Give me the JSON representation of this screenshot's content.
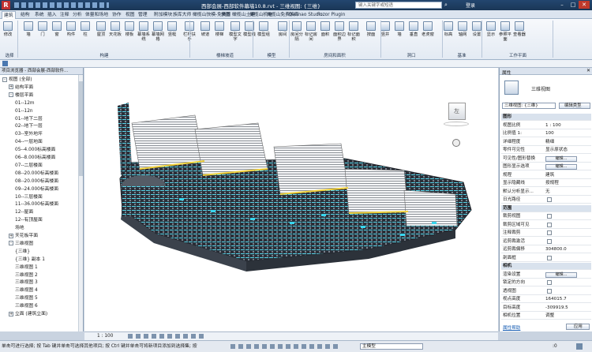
{
  "titlebar": {
    "title": "西部会展-西部软件幕墙10.8.rvt - 三维视图: {三维}",
    "search_placeholder": "键入关键字或短语",
    "user": "登录"
  },
  "tabs": [
    "建筑",
    "结构",
    "系统",
    "插入",
    "注释",
    "分析",
    "体量和场地",
    "协作",
    "视图",
    "管理",
    "附加模块",
    "族库大师",
    "橄榄山快模-免费版",
    "快图",
    "橄榄山土建",
    "橄榄山机电",
    "橄榄山免费族库",
    "Daimao Studio",
    "Fuzor Plugin"
  ],
  "ribbon": {
    "buttons": [
      "修改",
      "墙",
      "门",
      "窗",
      "构件",
      "柱",
      "屋顶",
      "天花板",
      "楼板",
      "幕墙系统",
      "幕墙网格",
      "竖梃",
      "栏杆扶手",
      "坡道",
      "楼梯",
      "模型文字",
      "模型线",
      "模型组",
      "房间",
      "房间分隔",
      "标记房间",
      "面积",
      "面积边界",
      "标记面积",
      "按面",
      "竖井",
      "墙",
      "垂直",
      "老虎窗",
      "标高",
      "轴网",
      "设置",
      "显示",
      "参照平面",
      "查看器"
    ],
    "groups": [
      "选择",
      "构建",
      "楼梯坡道",
      "模型",
      "房间和面积",
      "洞口",
      "基准",
      "工作平面"
    ]
  },
  "browser": {
    "title": "项目浏览器 - 西部会展-西部软件...",
    "rows": [
      {
        "label": "视图 (全部)",
        "level": 0,
        "exp": "-"
      },
      {
        "label": "结构平面",
        "level": 1,
        "exp": "+"
      },
      {
        "label": "楼层平面",
        "level": 1,
        "exp": "-"
      },
      {
        "label": "01--12m",
        "level": 2,
        "exp": ""
      },
      {
        "label": "01--12n",
        "level": 2,
        "exp": ""
      },
      {
        "label": "01--地下二层",
        "level": 2,
        "exp": ""
      },
      {
        "label": "02--地下一层",
        "level": 2,
        "exp": ""
      },
      {
        "label": "03--室外地坪",
        "level": 2,
        "exp": ""
      },
      {
        "label": "04--一层地面",
        "level": 2,
        "exp": ""
      },
      {
        "label": "05--4.000标高楼面",
        "level": 2,
        "exp": ""
      },
      {
        "label": "06--8.000标高楼面",
        "level": 2,
        "exp": ""
      },
      {
        "label": "07--二层楼面",
        "level": 2,
        "exp": ""
      },
      {
        "label": "08--20.000标高楼面",
        "level": 2,
        "exp": ""
      },
      {
        "label": "08--20.000标高楼面",
        "level": 2,
        "exp": ""
      },
      {
        "label": "09--24.000标高楼面",
        "level": 2,
        "exp": ""
      },
      {
        "label": "10--三层楼面",
        "level": 2,
        "exp": ""
      },
      {
        "label": "11--36.000标高楼面",
        "level": 2,
        "exp": ""
      },
      {
        "label": "12--屋面",
        "level": 2,
        "exp": ""
      },
      {
        "label": "12--有顶屋面",
        "level": 2,
        "exp": ""
      },
      {
        "label": "场地",
        "level": 2,
        "exp": ""
      },
      {
        "label": "天花板平面",
        "level": 1,
        "exp": "+"
      },
      {
        "label": "三维视图",
        "level": 1,
        "exp": "-"
      },
      {
        "label": "{三维}",
        "level": 2,
        "exp": ""
      },
      {
        "label": "{三维} 副本 1",
        "level": 2,
        "exp": ""
      },
      {
        "label": "三维视图 1",
        "level": 2,
        "exp": ""
      },
      {
        "label": "三维视图 2",
        "level": 2,
        "exp": ""
      },
      {
        "label": "三维视图 3",
        "level": 2,
        "exp": ""
      },
      {
        "label": "三维视图 4",
        "level": 2,
        "exp": ""
      },
      {
        "label": "三维视图 5",
        "level": 2,
        "exp": ""
      },
      {
        "label": "三维视图 6",
        "level": 2,
        "exp": ""
      },
      {
        "label": "立面 (建筑立面)",
        "level": 1,
        "exp": "+"
      }
    ]
  },
  "viewbar": {
    "scale": "1 : 100"
  },
  "props": {
    "title": "属性",
    "type_name": "三维视图",
    "selector": "三维视图: {三维}",
    "edit_type": "编辑类型",
    "rows": [
      {
        "k": "图形",
        "v": "",
        "sec": true
      },
      {
        "k": "视图比例",
        "v": "1 : 100"
      },
      {
        "k": "比例值 1:",
        "v": "100"
      },
      {
        "k": "详细程度",
        "v": "精细"
      },
      {
        "k": "零件可见性",
        "v": "显示原状态"
      },
      {
        "k": "可见性/图形替换",
        "v": "编辑...",
        "btn": true
      },
      {
        "k": "图形显示选项",
        "v": "编辑...",
        "btn": true
      },
      {
        "k": "规程",
        "v": "建筑"
      },
      {
        "k": "显示隐藏线",
        "v": "按规程"
      },
      {
        "k": "默认分析显示...",
        "v": "无"
      },
      {
        "k": "日光路径",
        "v": "",
        "chk": true
      },
      {
        "k": "范围",
        "v": "",
        "sec": true
      },
      {
        "k": "裁剪视图",
        "v": "",
        "chk": true
      },
      {
        "k": "裁剪区域可见",
        "v": "",
        "chk": true
      },
      {
        "k": "注释裁剪",
        "v": "",
        "chk": true
      },
      {
        "k": "远剪裁激活",
        "v": "",
        "chk": true
      },
      {
        "k": "远剪裁偏移",
        "v": "304800.0"
      },
      {
        "k": "剖面框",
        "v": "",
        "chk": true
      },
      {
        "k": "相机",
        "v": "",
        "sec": true
      },
      {
        "k": "渲染设置",
        "v": "编辑...",
        "btn": true
      },
      {
        "k": "锁定的方向",
        "v": "",
        "chk": true
      },
      {
        "k": "透视图",
        "v": "",
        "chk": true
      },
      {
        "k": "视点高度",
        "v": "164015.7"
      },
      {
        "k": "目标高度",
        "v": "-309919.5"
      },
      {
        "k": "相机位置",
        "v": "调整"
      }
    ],
    "help_link": "属性帮助",
    "apply": "应用"
  },
  "status": {
    "text": "单击可进行选择; 按 Tab 键并单击可选择其他项目; 按 Ctrl 键并单击可将新项目添加到选择集; 按",
    "model": "主模型",
    "zoom": ":0"
  },
  "viewcube": {
    "face": "左"
  },
  "colors": {
    "titlebar": "#1a3656",
    "ribbon": "#e3eaf3",
    "accent": "#0a8fd0"
  }
}
